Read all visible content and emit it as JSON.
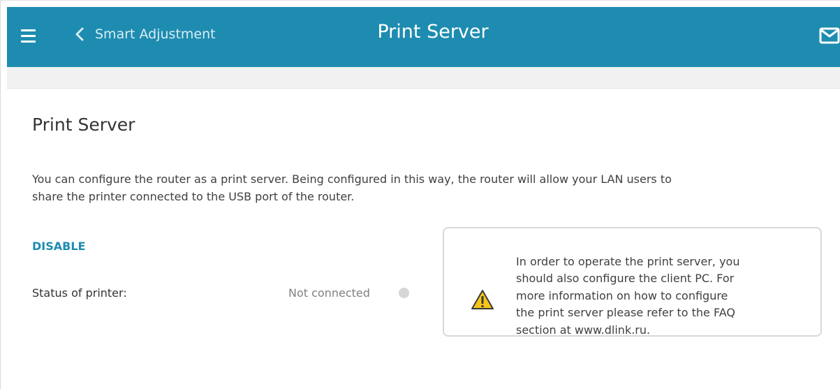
{
  "header": {
    "back_label": "Smart Adjustment",
    "title": "Print Server",
    "menu_icon": "hamburger-menu-icon",
    "back_icon": "chevron-left-icon",
    "mail_icon": "envelope-icon",
    "background_color": "#1e8cb0"
  },
  "main": {
    "heading": "Print Server",
    "description_lines": [
      "You can configure the router as a print server. Being configured in this way, the router will allow your LAN users to",
      "share the printer connected to the USB port of the router."
    ],
    "toggle_label": "DISABLE",
    "status": {
      "label": "Status of printer:",
      "value": "Not connected",
      "indicator_color": "#d6d6d6"
    }
  },
  "info_box": {
    "icon": "warning-triangle-icon",
    "lines": [
      "In order to operate the print server, you",
      "should also configure the client PC. For",
      "more information on how to configure",
      "the print server please refer to the FAQ",
      "section at www.dlink.ru."
    ]
  }
}
